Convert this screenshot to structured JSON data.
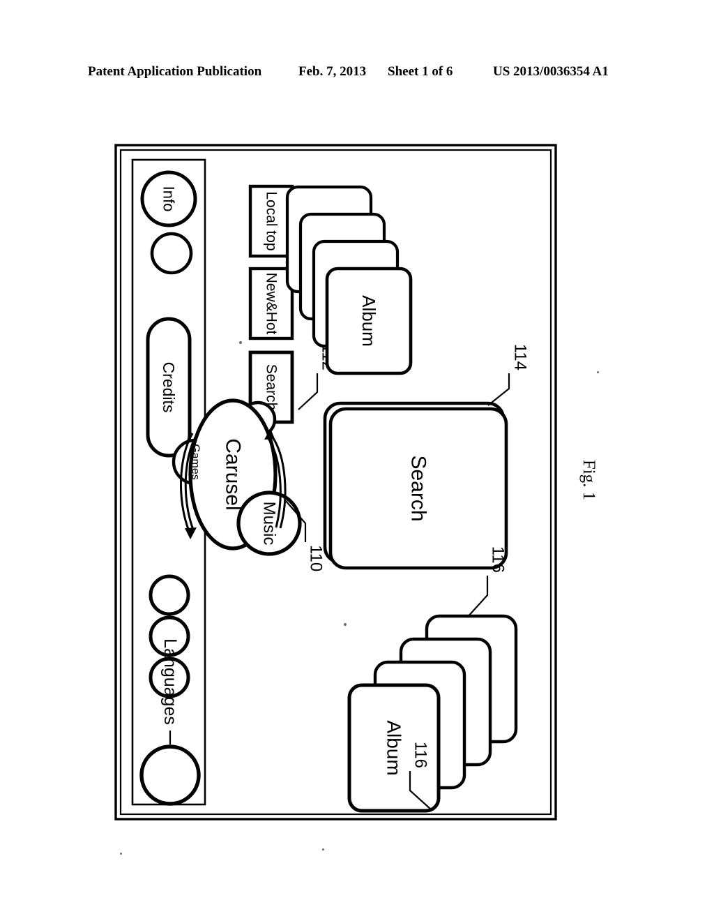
{
  "page": {
    "header": {
      "publication": "Patent Application Publication",
      "date": "Feb. 7, 2013",
      "sheet": "Sheet 1 of 6",
      "document_number": "US 2013/0036354 A1"
    },
    "figure_caption": "Fig. 1"
  },
  "figure": {
    "reference_numerals": {
      "carousel": "110",
      "menu_buttons": "112",
      "search_panel": "114",
      "album_stack_top_left": "116",
      "album_stack_top_right": "116"
    },
    "carousel": {
      "label": "Carusel",
      "nodes": [
        {
          "label": "Music",
          "size": "large"
        },
        {
          "label": "Games",
          "size": "medium"
        },
        {
          "label": "",
          "size": "small"
        }
      ]
    },
    "search_panel": {
      "label": "Search"
    },
    "album_stacks": [
      {
        "id": "upper",
        "card_count": 4,
        "front_label": "Album"
      },
      {
        "id": "lower",
        "card_count": 4,
        "front_label": "Album"
      }
    ],
    "menu_buttons": [
      {
        "label": "Local top"
      },
      {
        "label": "New&Hot"
      },
      {
        "label": "Search"
      }
    ],
    "sidebar": {
      "languages_label": "Languages",
      "language_slots": 4,
      "credits_label": "Credits",
      "info_label": "Info",
      "extra_slot_count": 1
    },
    "colors": {
      "ink": "#000000",
      "paper": "#ffffff"
    }
  }
}
